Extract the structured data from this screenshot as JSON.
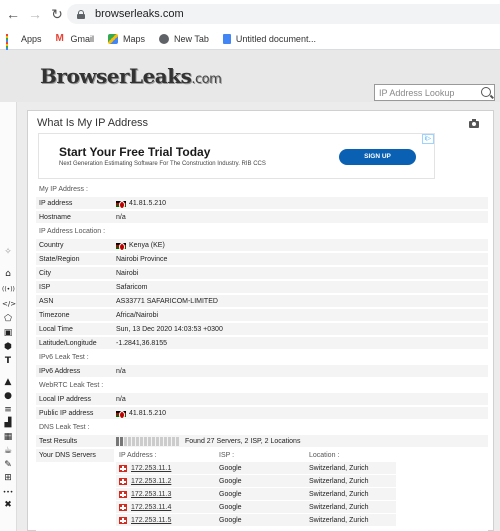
{
  "browser": {
    "url": "browserleaks.com",
    "bookmarks": [
      {
        "label": "Apps",
        "icon": "apps-icon"
      },
      {
        "label": "Gmail",
        "icon": "gmail-icon"
      },
      {
        "label": "Maps",
        "icon": "maps-icon"
      },
      {
        "label": "New Tab",
        "icon": "globe-icon"
      },
      {
        "label": "Untitled document...",
        "icon": "google-docs-icon"
      }
    ]
  },
  "site": {
    "logo": "BrowserLeaks",
    "logo_tld": ".com",
    "search_placeholder": "IP Address Lookup"
  },
  "page": {
    "title": "What Is My IP Address"
  },
  "ad": {
    "headline": "Start Your Free Trial Today",
    "description": "Next Generation Estimating Software For The Construction Industry. RIB CCS",
    "cta": "SIGN UP",
    "badge": "i▷"
  },
  "sections": {
    "my_ip": "My IP Address :",
    "location": "IP Address Location :",
    "ipv6": "IPv6 Leak Test :",
    "webrtc": "WebRTC Leak Test :",
    "dns": "DNS Leak Test :"
  },
  "fields": {
    "ip_address": {
      "label": "IP address",
      "value": "41.81.5.210"
    },
    "hostname": {
      "label": "Hostname",
      "value": "n/a"
    },
    "country": {
      "label": "Country",
      "value": "Kenya (KE)"
    },
    "state": {
      "label": "State/Region",
      "value": "Nairobi Province"
    },
    "city": {
      "label": "City",
      "value": "Nairobi"
    },
    "isp": {
      "label": "ISP",
      "value": "Safaricom"
    },
    "asn": {
      "label": "ASN",
      "value": "AS33771 SAFARICOM-LIMITED"
    },
    "timezone": {
      "label": "Timezone",
      "value": "Africa/Nairobi"
    },
    "local_time": {
      "label": "Local Time",
      "value": "Sun, 13 Dec 2020 14:03:53 +0300"
    },
    "latlong": {
      "label": "Latitude/Longitude",
      "value": "-1.2841,36.8155"
    },
    "ipv6": {
      "label": "IPv6 Address",
      "value": "n/a"
    },
    "local_ip": {
      "label": "Local IP address",
      "value": "n/a"
    },
    "public_ip": {
      "label": "Public IP address",
      "value": "41.81.5.210"
    },
    "test_results": {
      "label": "Test Results",
      "value": "Found 27 Servers, 2 ISP, 2 Locations"
    },
    "dns_servers": {
      "label": "Your DNS Servers"
    }
  },
  "dns": {
    "headers": {
      "ip": "IP Address :",
      "isp": "ISP :",
      "location": "Location :"
    },
    "rows": [
      {
        "ip": "172.253.11.1",
        "isp": "Google",
        "location": "Switzerland, Zurich"
      },
      {
        "ip": "172.253.11.2",
        "isp": "Google",
        "location": "Switzerland, Zurich"
      },
      {
        "ip": "172.253.11.3",
        "isp": "Google",
        "location": "Switzerland, Zurich"
      },
      {
        "ip": "172.253.11.4",
        "isp": "Google",
        "location": "Switzerland, Zurich"
      },
      {
        "ip": "172.253.11.5",
        "isp": "Google",
        "location": "Switzerland, Zurich"
      }
    ]
  },
  "tools": [
    {
      "name": "home-icon",
      "glyph": "⌂"
    },
    {
      "name": "broadcast-icon",
      "glyph": "((•))"
    },
    {
      "name": "code-icon",
      "glyph": "</>"
    },
    {
      "name": "shape-icon",
      "glyph": "⬠"
    },
    {
      "name": "image-icon",
      "glyph": "▣"
    },
    {
      "name": "cube-icon",
      "glyph": "⬢"
    },
    {
      "name": "font-icon",
      "glyph": "T"
    },
    {
      "name": "lock-icon",
      "glyph": "▲"
    },
    {
      "name": "location-pin-icon",
      "glyph": "●"
    },
    {
      "name": "stack-icon",
      "glyph": "≡"
    },
    {
      "name": "bar-chart-icon",
      "glyph": "▟"
    },
    {
      "name": "grid-icon",
      "glyph": "▦"
    },
    {
      "name": "cup-icon",
      "glyph": "☕"
    },
    {
      "name": "wrench-icon",
      "glyph": "✎"
    },
    {
      "name": "windows-icon",
      "glyph": "⊞"
    },
    {
      "name": "more-icon",
      "glyph": "•••"
    },
    {
      "name": "tools-icon",
      "glyph": "✖"
    }
  ]
}
